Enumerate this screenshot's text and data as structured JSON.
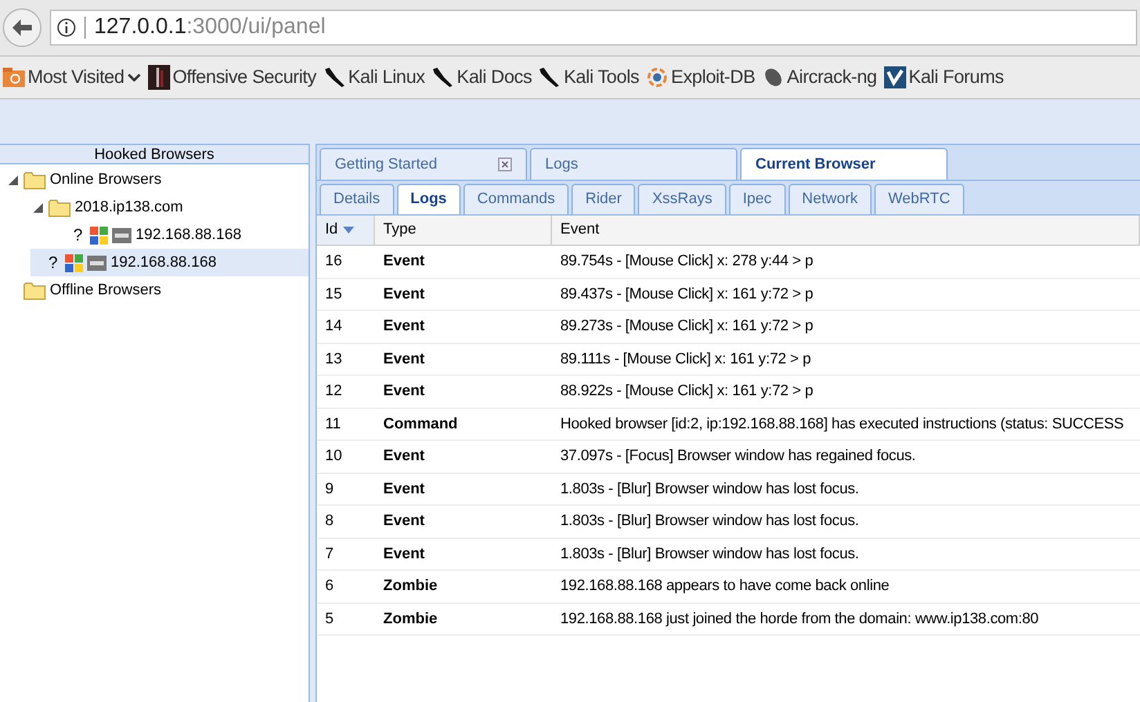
{
  "address_bar": {
    "host": "127.0.0.1",
    "path": ":3000/ui/panel"
  },
  "bookmarks": [
    {
      "label": "Most Visited",
      "kind": "folder"
    },
    {
      "label": "Offensive Security",
      "kind": "offsec"
    },
    {
      "label": "Kali Linux",
      "kind": "kali"
    },
    {
      "label": "Kali Docs",
      "kind": "kali"
    },
    {
      "label": "Kali Tools",
      "kind": "kali"
    },
    {
      "label": "Exploit-DB",
      "kind": "exploit"
    },
    {
      "label": "Aircrack-ng",
      "kind": "aircrack"
    },
    {
      "label": "Kali Forums",
      "kind": "forums"
    }
  ],
  "sidebar": {
    "title": "Hooked Browsers",
    "tree": [
      {
        "label": "Online Browsers",
        "kind": "folder",
        "expanded": true,
        "selected": false,
        "children": [
          {
            "label": "2018.ip138.com",
            "kind": "folder",
            "expanded": true,
            "selected": false,
            "children": [
              {
                "label": "192.168.88.168",
                "kind": "browser",
                "status": "?",
                "selected": false
              }
            ]
          },
          {
            "label": "192.168.88.168",
            "kind": "browser",
            "status": "?",
            "selected": true
          }
        ]
      },
      {
        "label": "Offline Browsers",
        "kind": "folder",
        "selected": false
      }
    ]
  },
  "main_tabs": [
    {
      "label": "Getting Started",
      "selected": false,
      "closable": true
    },
    {
      "label": "Logs",
      "selected": false,
      "closable": false
    },
    {
      "label": "Current Browser",
      "selected": true,
      "closable": false
    }
  ],
  "sub_tabs": [
    {
      "label": "Details",
      "selected": false
    },
    {
      "label": "Logs",
      "selected": true
    },
    {
      "label": "Commands",
      "selected": false
    },
    {
      "label": "Rider",
      "selected": false
    },
    {
      "label": "XssRays",
      "selected": false
    },
    {
      "label": "Ipec",
      "selected": false
    },
    {
      "label": "Network",
      "selected": false
    },
    {
      "label": "WebRTC",
      "selected": false
    }
  ],
  "table": {
    "columns": [
      "Id",
      "Type",
      "Event"
    ],
    "rows": [
      [
        "16",
        "Event",
        "89.754s - [Mouse Click] x: 278 y:44 > p"
      ],
      [
        "15",
        "Event",
        "89.437s - [Mouse Click] x: 161 y:72 > p"
      ],
      [
        "14",
        "Event",
        "89.273s - [Mouse Click] x: 161 y:72 > p"
      ],
      [
        "13",
        "Event",
        "89.111s - [Mouse Click] x: 161 y:72 > p"
      ],
      [
        "12",
        "Event",
        "88.922s - [Mouse Click] x: 161 y:72 > p"
      ],
      [
        "11",
        "Command",
        "Hooked browser [id:2, ip:192.168.88.168] has executed instructions (status: SUCCESS"
      ],
      [
        "10",
        "Event",
        "37.097s - [Focus] Browser window has regained focus."
      ],
      [
        "9",
        "Event",
        "1.803s - [Blur] Browser window has lost focus."
      ],
      [
        "8",
        "Event",
        "1.803s - [Blur] Browser window has lost focus."
      ],
      [
        "7",
        "Event",
        "1.803s - [Blur] Browser window has lost focus."
      ],
      [
        "6",
        "Zombie",
        "192.168.88.168 appears to have come back online"
      ],
      [
        "5",
        "Zombie",
        "192.168.88.168 just joined the horde from the domain: www.ip138.com:80"
      ]
    ]
  }
}
